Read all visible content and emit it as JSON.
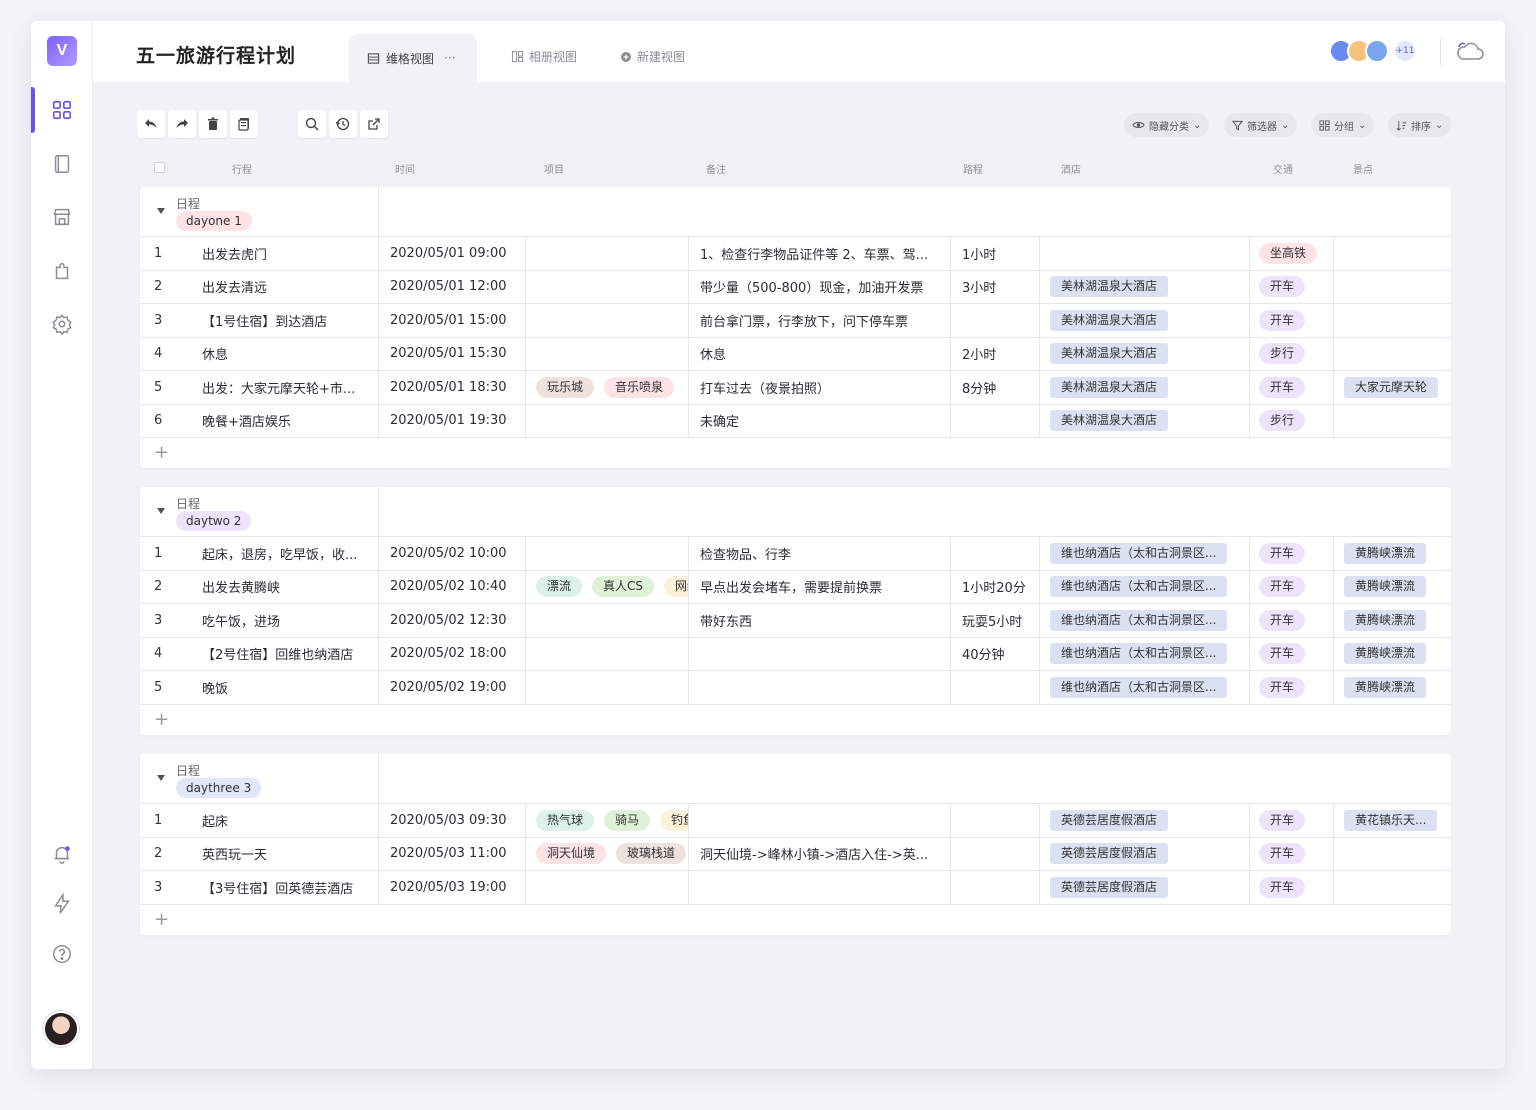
{
  "colors": {
    "accent": "#6b52ee",
    "hotel_tag": "#dbe1f3",
    "transport_tag": "#ece4fb",
    "rail_tag": "#fde2e6"
  },
  "header": {
    "title": "五一旅游行程计划",
    "tabs": [
      {
        "label": "维格视图",
        "active": true,
        "more": "···"
      },
      {
        "label": "相册视图"
      },
      {
        "label": "新建视图"
      }
    ],
    "member_count": "+11"
  },
  "toolbar": {
    "buttons": [
      "undo-icon",
      "redo-icon",
      "trash-icon",
      "copy-icon",
      "search-icon",
      "history-icon",
      "share-icon"
    ],
    "hide_fields": "隐藏分类",
    "filter": "筛选器",
    "group": "分组",
    "sort": "排序"
  },
  "columns": [
    "行程",
    "时间",
    "项目",
    "备注",
    "路程",
    "酒店",
    "交通",
    "景点"
  ],
  "groups": [
    {
      "label": "日程",
      "tag": "dayone 1",
      "tag_color": "#fde2e6",
      "rows": [
        {
          "n": "1",
          "name": "出发去虎门",
          "time": "2020/05/01  09:00",
          "items": [],
          "note": "1、检查行李物品证件等 2、车票、驾...",
          "route": "1小时",
          "hotel": "",
          "trans": "坐高铁",
          "trans_color": "pink",
          "spot": ""
        },
        {
          "n": "2",
          "name": "出发去清远",
          "time": "2020/05/01  12:00",
          "items": [],
          "note": "带少量（500-800）现金，加油开发票",
          "route": "3小时",
          "hotel": "美林湖温泉大酒店",
          "trans": "开车",
          "spot": ""
        },
        {
          "n": "3",
          "name": "【1号住宿】到达酒店",
          "time": "2020/05/01  15:00",
          "items": [],
          "note": "前台拿门票，行李放下，问下停车票",
          "route": "",
          "hotel": "美林湖温泉大酒店",
          "trans": "开车",
          "spot": ""
        },
        {
          "n": "4",
          "name": "休息",
          "time": "2020/05/01  15:30",
          "items": [],
          "note": "休息",
          "route": "2小时",
          "hotel": "美林湖温泉大酒店",
          "trans": "步行",
          "spot": ""
        },
        {
          "n": "5",
          "name": "出发：大家元摩天轮+市...",
          "time": "2020/05/01  18:30",
          "items": [
            {
              "t": "玩乐城",
              "c": "#eee2df"
            },
            {
              "t": "音乐喷泉",
              "c": "#fde2e6"
            }
          ],
          "note": "打车过去（夜景拍照）",
          "route": "8分钟",
          "hotel": "美林湖温泉大酒店",
          "trans": "开车",
          "spot": "大家元摩天轮"
        },
        {
          "n": "6",
          "name": "晚餐+酒店娱乐",
          "time": "2020/05/01  19:30",
          "items": [],
          "note": "未确定",
          "route": "",
          "hotel": "美林湖温泉大酒店",
          "trans": "步行",
          "spot": ""
        }
      ]
    },
    {
      "label": "日程",
      "tag": "daytwo 2",
      "tag_color": "#ece4fb",
      "rows": [
        {
          "n": "1",
          "name": "起床，退房，吃早饭，收...",
          "time": "2020/05/02  10:00",
          "items": [],
          "note": "检查物品、行李",
          "route": "",
          "hotel": "维也纳酒店（太和古洞景区...",
          "trans": "开车",
          "spot": "黄腾峡漂流"
        },
        {
          "n": "2",
          "name": "出发去黄腾峡",
          "time": "2020/05/02  10:40",
          "items": [
            {
              "t": "漂流",
              "c": "#dcf1ea"
            },
            {
              "t": "真人CS",
              "c": "#dff2d8"
            },
            {
              "t": "网红",
              "c": "#fcf1d9"
            }
          ],
          "note": "早点出发会堵车，需要提前换票",
          "route": "1小时20分",
          "hotel": "维也纳酒店（太和古洞景区...",
          "trans": "开车",
          "spot": "黄腾峡漂流"
        },
        {
          "n": "3",
          "name": "吃午饭，进场",
          "time": "2020/05/02  12:30",
          "items": [],
          "note": "带好东西",
          "route": "玩耍5小时",
          "hotel": "维也纳酒店（太和古洞景区...",
          "trans": "开车",
          "spot": "黄腾峡漂流"
        },
        {
          "n": "4",
          "name": "【2号住宿】回维也纳酒店",
          "time": "2020/05/02  18:00",
          "items": [],
          "note": "",
          "route": "40分钟",
          "hotel": "维也纳酒店（太和古洞景区...",
          "trans": "开车",
          "spot": "黄腾峡漂流"
        },
        {
          "n": "5",
          "name": "晚饭",
          "time": "2020/05/02  19:00",
          "items": [],
          "note": "",
          "route": "",
          "hotel": "维也纳酒店（太和古洞景区...",
          "trans": "开车",
          "spot": "黄腾峡漂流"
        }
      ]
    },
    {
      "label": "日程",
      "tag": "daythree 3",
      "tag_color": "#e2e6fb",
      "rows": [
        {
          "n": "1",
          "name": "起床",
          "time": "2020/05/03  09:30",
          "items": [
            {
              "t": "热气球",
              "c": "#dcf1ea"
            },
            {
              "t": "骑马",
              "c": "#dff2d8"
            },
            {
              "t": "钓鱼",
              "c": "#fcf1d9"
            }
          ],
          "note": "",
          "route": "",
          "hotel": "英德芸居度假酒店",
          "trans": "开车",
          "spot": "黄花镇乐天..."
        },
        {
          "n": "2",
          "name": "英西玩一天",
          "time": "2020/05/03  11:00",
          "items": [
            {
              "t": "洞天仙境",
              "c": "#fde2e6"
            },
            {
              "t": "玻璃栈道",
              "c": "#eee2df"
            }
          ],
          "note": "洞天仙境->峰林小镇->酒店入住->英...",
          "route": "",
          "hotel": "英德芸居度假酒店",
          "trans": "开车",
          "spot": ""
        },
        {
          "n": "3",
          "name": "【3号住宿】回英德芸酒店",
          "time": "2020/05/03  19:00",
          "items": [],
          "note": "",
          "route": "",
          "hotel": "英德芸居度假酒店",
          "trans": "开车",
          "spot": ""
        }
      ]
    }
  ],
  "add_row": "+"
}
